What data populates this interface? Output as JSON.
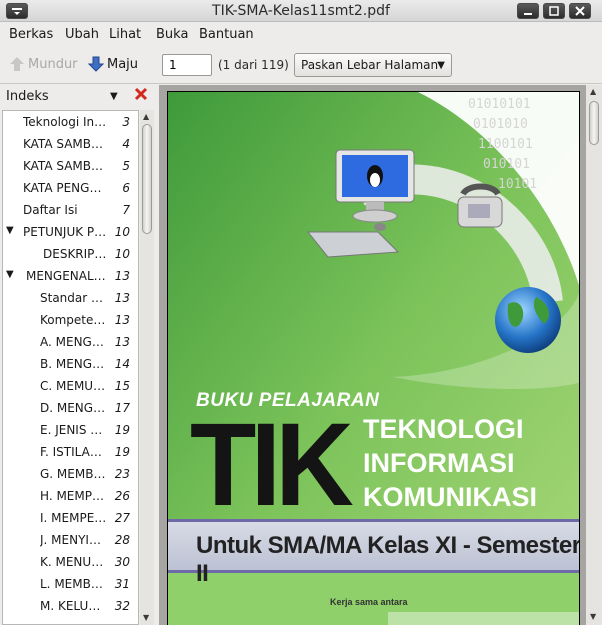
{
  "window": {
    "title": "TIK-SMA-Kelas11smt2.pdf"
  },
  "menu": [
    "Berkas",
    "Ubah",
    "Lihat",
    "Buka",
    "Bantuan"
  ],
  "toolbar": {
    "back_label": "Mundur",
    "forward_label": "Maju",
    "page_value": "1",
    "page_count": "(1 dari 119)",
    "zoom_value": "Paskan Lebar Halaman"
  },
  "sidebar": {
    "header": "Indeks",
    "items": [
      {
        "label": "Teknologi Info…",
        "page": "3"
      },
      {
        "label": "KATA SAMBUT…",
        "page": "4"
      },
      {
        "label": "KATA SAMBUT…",
        "page": "5"
      },
      {
        "label": "KATA PENGAN…",
        "page": "6"
      },
      {
        "label": "Daftar Isi",
        "page": "7"
      },
      {
        "label": "PETUNJUK PEN…",
        "page": "10"
      },
      {
        "label": "DESKRIPSI …",
        "page": "10"
      },
      {
        "label": "MENGENAL O…",
        "page": "13"
      },
      {
        "label": "Standar Ko…",
        "page": "13"
      },
      {
        "label": "Kompetens…",
        "page": "13"
      },
      {
        "label": "A.  MENGE…",
        "page": "13"
      },
      {
        "label": "B.  MENGE…",
        "page": "14"
      },
      {
        "label": "C.  MEMUL…",
        "page": "15"
      },
      {
        "label": "D.   MENGE…",
        "page": "17"
      },
      {
        "label": "E.  JENIS D…",
        "page": "19"
      },
      {
        "label": "F.  ISTILAH …",
        "page": "19"
      },
      {
        "label": "G.  MEMBU…",
        "page": "23"
      },
      {
        "label": "H.  MEMPE…",
        "page": "26"
      },
      {
        "label": "I.  MEMPER…",
        "page": "27"
      },
      {
        "label": "J.  MENYIMP…",
        "page": "28"
      },
      {
        "label": "K.  MENUTU…",
        "page": "30"
      },
      {
        "label": "L.  MEMBU…",
        "page": "31"
      },
      {
        "label": "M.  KELUAR …",
        "page": "32"
      }
    ]
  },
  "cover": {
    "buku": "BUKU PELAJARAN",
    "tik": "TIK",
    "line1": "TEKNOLOGI",
    "line2": "INFORMASI",
    "line3": "KOMUNIKASI",
    "band": "Untuk SMA/MA Kelas XI - Semester II",
    "kerja": "Kerja sama antara",
    "binary": "1010101010101010101100101010101010101010110010101010101010101010110010101010101010101101"
  },
  "colors": {
    "cover_green": "#5bb04a",
    "accent_red": "#d2281e"
  }
}
